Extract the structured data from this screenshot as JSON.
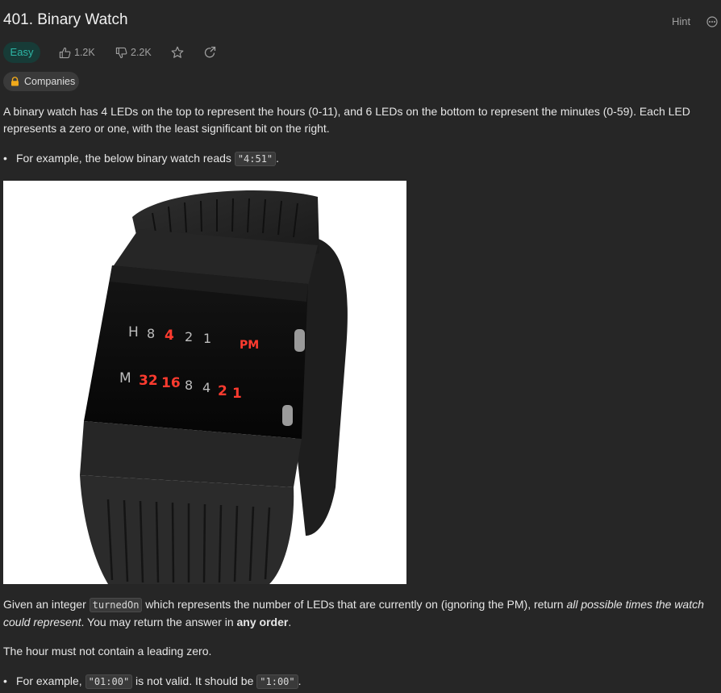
{
  "problem": {
    "title": "401. Binary Watch",
    "hint_label": "Hint",
    "difficulty": "Easy",
    "likes": "1.2K",
    "dislikes": "2.2K",
    "companies_label": "Companies"
  },
  "description": {
    "p1": "A binary watch has 4 LEDs on the top to represent the hours (0-11), and 6 LEDs on the bottom to represent the minutes (0-59). Each LED represents a zero or one, with the least significant bit on the right.",
    "example1_prefix": "For example, the below binary watch reads ",
    "example1_code": "\"4:51\"",
    "example1_suffix": ".",
    "p2_before": "Given an integer ",
    "p2_code": "turnedOn",
    "p2_mid": " which represents the number of LEDs that are currently on (ignoring the PM), return ",
    "p2_emph": "all possible times the watch could represent",
    "p2_after": ". You may return the answer in ",
    "p2_strong": "any order",
    "p2_end": ".",
    "p3": "The hour must not contain a leading zero.",
    "example2_prefix": "For example, ",
    "example2_code1": "\"01:00\"",
    "example2_mid": " is not valid. It should be ",
    "example2_code2": "\"1:00\"",
    "example2_suffix": "."
  },
  "watch": {
    "hour_letter": "H",
    "hours": [
      {
        "v": "8",
        "on": false
      },
      {
        "v": "4",
        "on": true
      },
      {
        "v": "2",
        "on": false
      },
      {
        "v": "1",
        "on": false
      }
    ],
    "pm": "PM",
    "minute_letter": "M",
    "minutes": [
      {
        "v": "32",
        "on": true
      },
      {
        "v": "16",
        "on": true
      },
      {
        "v": "8",
        "on": false
      },
      {
        "v": "4",
        "on": false
      },
      {
        "v": "2",
        "on": true
      },
      {
        "v": "1",
        "on": true
      }
    ]
  },
  "colors": {
    "accent_easy": "#2db7a6",
    "led_on": "#ff3b2f",
    "led_off": "#bdbdbd",
    "background": "#262626"
  }
}
